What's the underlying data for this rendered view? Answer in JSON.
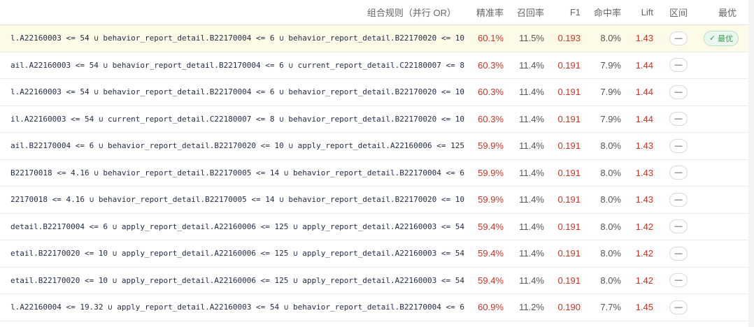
{
  "header": {
    "rule": "组合规则（并行 OR）",
    "precision": "精准率",
    "recall": "召回率",
    "f1": "F1",
    "hit_rate": "命中率",
    "lift": "Lift",
    "range": "区间",
    "best": "最优"
  },
  "best_badge": {
    "icon": "✓",
    "label": "最优"
  },
  "range_label": "—",
  "rows": [
    {
      "rule": "l.A22160003 <= 54 ∪ behavior_report_detail.B22170004 <= 6 ∪ behavior_report_detail.B22170020 <= 10",
      "precision": "60.1%",
      "recall": "11.5%",
      "f1": "0.193",
      "hit_rate": "8.0%",
      "lift": "1.43"
    },
    {
      "rule": "ail.A22160003 <= 54 ∪ behavior_report_detail.B22170004 <= 6 ∪ current_report_detail.C22180007 <= 8",
      "precision": "60.3%",
      "recall": "11.4%",
      "f1": "0.191",
      "hit_rate": "7.9%",
      "lift": "1.44"
    },
    {
      "rule": "l.A22160003 <= 54 ∪ behavior_report_detail.B22170004 <= 6 ∪ behavior_report_detail.B22170020 <= 10",
      "precision": "60.3%",
      "recall": "11.4%",
      "f1": "0.191",
      "hit_rate": "7.9%",
      "lift": "1.44"
    },
    {
      "rule": "il.A22160003 <= 54 ∪ current_report_detail.C22180007 <= 8 ∪ behavior_report_detail.B22170020 <= 10",
      "precision": "60.3%",
      "recall": "11.4%",
      "f1": "0.191",
      "hit_rate": "7.9%",
      "lift": "1.44"
    },
    {
      "rule": "ail.B22170004 <= 6 ∪ behavior_report_detail.B22170020 <= 10 ∪ apply_report_detail.A22160006 <= 125",
      "precision": "59.9%",
      "recall": "11.4%",
      "f1": "0.191",
      "hit_rate": "8.0%",
      "lift": "1.43"
    },
    {
      "rule": "B22170018 <= 4.16 ∪ behavior_report_detail.B22170005 <= 14 ∪ behavior_report_detail.B22170004 <= 6",
      "precision": "59.9%",
      "recall": "11.4%",
      "f1": "0.191",
      "hit_rate": "8.0%",
      "lift": "1.43"
    },
    {
      "rule": "22170018 <= 4.16 ∪ behavior_report_detail.B22170005 <= 14 ∪ behavior_report_detail.B22170020 <= 10",
      "precision": "59.9%",
      "recall": "11.4%",
      "f1": "0.191",
      "hit_rate": "8.0%",
      "lift": "1.43"
    },
    {
      "rule": "detail.B22170004 <= 6 ∪ apply_report_detail.A22160006 <= 125 ∪ apply_report_detail.A22160003 <= 54",
      "precision": "59.4%",
      "recall": "11.4%",
      "f1": "0.191",
      "hit_rate": "8.0%",
      "lift": "1.42"
    },
    {
      "rule": "etail.B22170020 <= 10 ∪ apply_report_detail.A22160006 <= 125 ∪ apply_report_detail.A22160003 <= 54",
      "precision": "59.4%",
      "recall": "11.4%",
      "f1": "0.191",
      "hit_rate": "8.0%",
      "lift": "1.42"
    },
    {
      "rule": "etail.B22170020 <= 10 ∪ apply_report_detail.A22160006 <= 125 ∪ apply_report_detail.A22160003 <= 54",
      "precision": "59.4%",
      "recall": "11.4%",
      "f1": "0.191",
      "hit_rate": "8.0%",
      "lift": "1.42"
    },
    {
      "rule": "l.A22160004 <= 19.32 ∪ apply_report_detail.A22160003 <= 54 ∪ behavior_report_detail.B22170004 <= 6",
      "precision": "60.9%",
      "recall": "11.2%",
      "f1": "0.190",
      "hit_rate": "7.7%",
      "lift": "1.45"
    }
  ],
  "best_row_index": 0
}
